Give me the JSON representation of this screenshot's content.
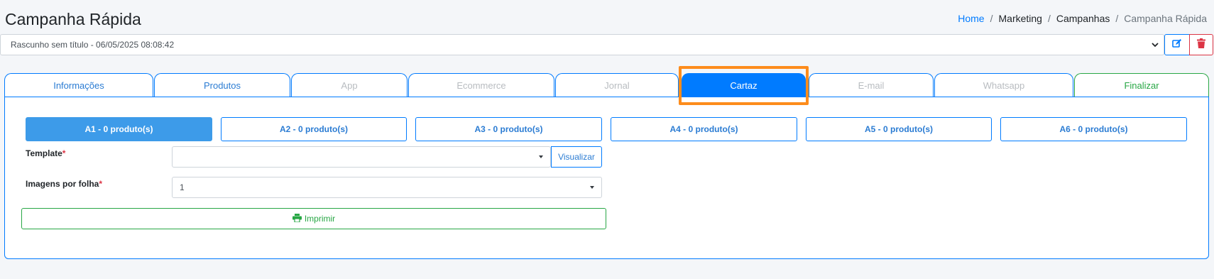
{
  "header": {
    "title": "Campanha Rápida",
    "breadcrumb": [
      "Home",
      "Marketing",
      "Campanhas",
      "Campanha Rápida"
    ]
  },
  "draft": {
    "selected": "Rascunho sem título - 06/05/2025 08:08:42",
    "edit_icon": "edit-icon",
    "delete_icon": "trash-icon"
  },
  "tabs": [
    {
      "label": "Informações",
      "state": "enabled"
    },
    {
      "label": "Produtos",
      "state": "enabled"
    },
    {
      "label": "App",
      "state": "disabled"
    },
    {
      "label": "Ecommerce",
      "state": "disabled"
    },
    {
      "label": "Jornal",
      "state": "disabled"
    },
    {
      "label": "Cartaz",
      "state": "active"
    },
    {
      "label": "E-mail",
      "state": "disabled"
    },
    {
      "label": "Whatsapp",
      "state": "disabled"
    },
    {
      "label": "Finalizar",
      "state": "finish"
    }
  ],
  "poster_tabs": [
    "A1 - 0 produto(s)",
    "A2 - 0 produto(s)",
    "A3 - 0 produto(s)",
    "A4 - 0 produto(s)",
    "A5 - 0 produto(s)",
    "A6 - 0 produto(s)"
  ],
  "form": {
    "template_label": "Template",
    "required_mark": "*",
    "template_value": "",
    "view_button": "Visualizar",
    "images_label": "Imagens por folha",
    "images_value": "1",
    "print_button": "Imprimir",
    "print_icon": "printer-icon"
  },
  "colors": {
    "primary": "#007bff",
    "danger": "#dc3545",
    "success": "#28a745",
    "highlight": "#fd8c1c",
    "active_poster_tab": "#3d9be9"
  }
}
